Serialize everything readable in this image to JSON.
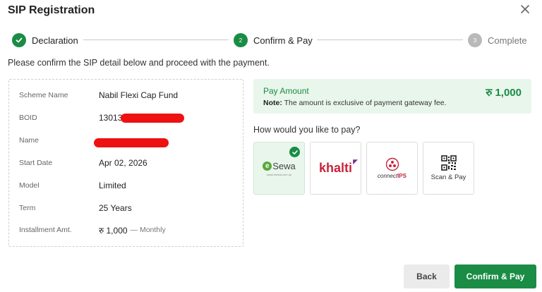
{
  "dialog": {
    "title": "SIP Registration"
  },
  "stepper": {
    "steps": [
      {
        "number": "1",
        "label": "Declaration",
        "state": "done"
      },
      {
        "number": "2",
        "label": "Confirm & Pay",
        "state": "active"
      },
      {
        "number": "3",
        "label": "Complete",
        "state": "todo"
      }
    ]
  },
  "intro_text": "Please confirm the SIP detail below and proceed with the payment.",
  "details": {
    "rows": [
      {
        "key": "Scheme Name",
        "value": "Nabil Flexi Cap Fund"
      },
      {
        "key": "BOID",
        "value": "13013",
        "redacted": true
      },
      {
        "key": "Name",
        "value": "",
        "redacted": true
      },
      {
        "key": "Start Date",
        "value": "Apr 02, 2026"
      },
      {
        "key": "Model",
        "value": "Limited"
      },
      {
        "key": "Term",
        "value": "25 Years"
      },
      {
        "key": "Installment Amt.",
        "value": "रु 1,000",
        "suffix": "— Monthly"
      }
    ]
  },
  "pay_amount": {
    "label": "Pay Amount",
    "amount": "रु 1,000",
    "note_label": "Note:",
    "note_text": "The amount is exclusive of payment gateway fee."
  },
  "payment": {
    "question": "How would you like to pay?",
    "options": [
      {
        "id": "esewa",
        "label": "eSewa",
        "sub": "www.esewa.com.np",
        "selected": true
      },
      {
        "id": "khalti",
        "label": "khalti",
        "selected": false
      },
      {
        "id": "connectips",
        "label_prefix": "connect",
        "label_suffix": "IPS",
        "selected": false
      },
      {
        "id": "scanpay",
        "label": "Scan & Pay",
        "selected": false
      }
    ]
  },
  "actions": {
    "back_label": "Back",
    "confirm_label": "Confirm & Pay"
  },
  "colors": {
    "primary": "#1a8c45",
    "primary_light": "#e9f6ec",
    "muted": "#b9b9b9",
    "redact": "#ee1111"
  }
}
